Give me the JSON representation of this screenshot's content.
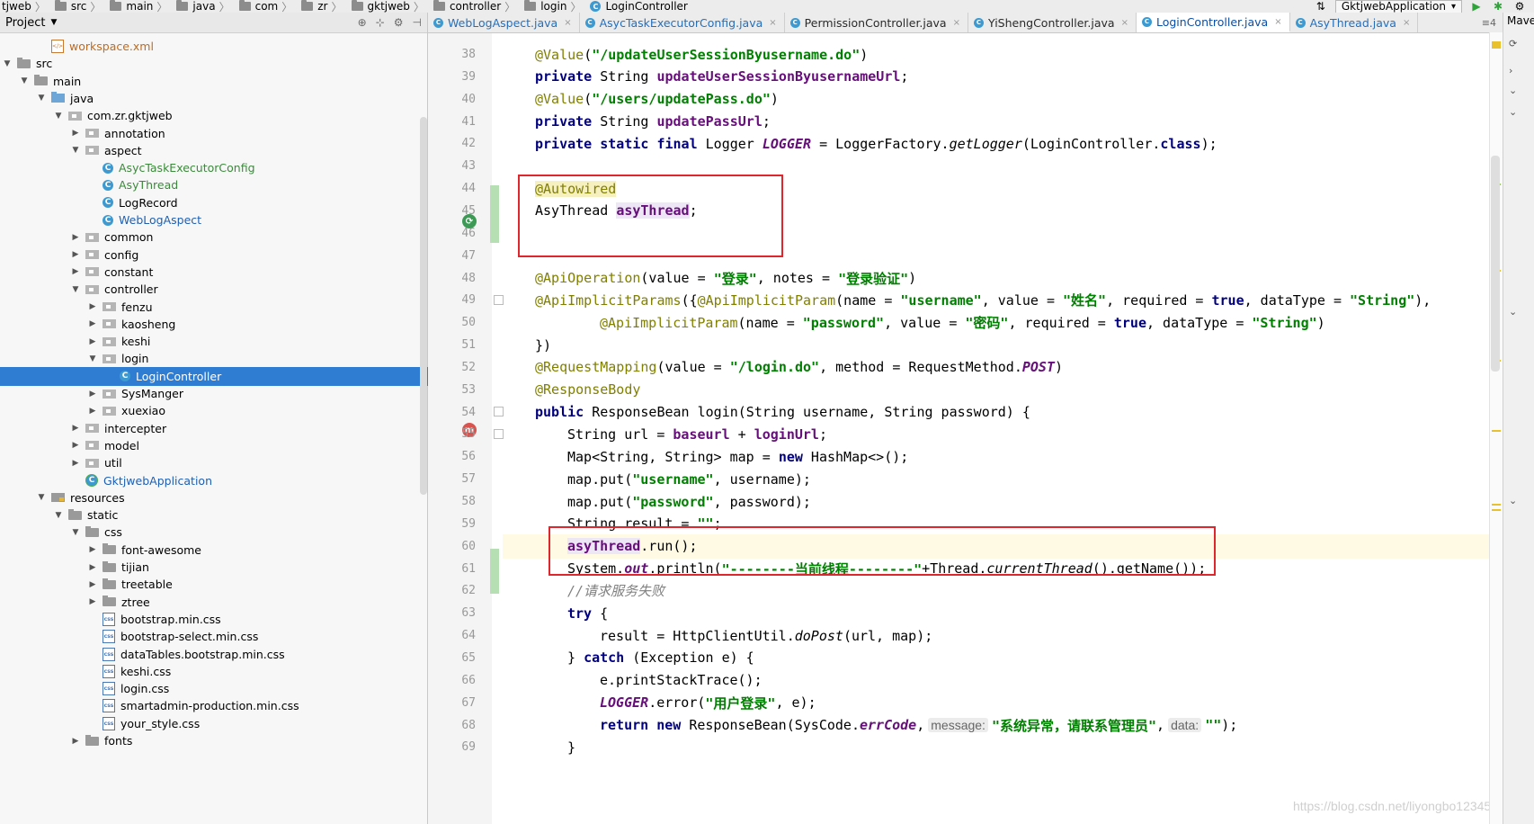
{
  "breadcrumb": [
    {
      "label": "tjweb",
      "icon": "none"
    },
    {
      "label": "src",
      "icon": "folder"
    },
    {
      "label": "main",
      "icon": "folder"
    },
    {
      "label": "java",
      "icon": "folder"
    },
    {
      "label": "com",
      "icon": "folder"
    },
    {
      "label": "zr",
      "icon": "folder"
    },
    {
      "label": "gktjweb",
      "icon": "folder"
    },
    {
      "label": "controller",
      "icon": "folder"
    },
    {
      "label": "login",
      "icon": "folder"
    },
    {
      "label": "LoginController",
      "icon": "class"
    }
  ],
  "run_config": {
    "label": "GktjwebApplication"
  },
  "project_panel": {
    "title": "Project"
  },
  "tree": [
    {
      "label": "workspace.xml",
      "depth": 2,
      "toggle": "",
      "icon": "xml",
      "color": "orange"
    },
    {
      "label": "src",
      "depth": 0,
      "toggle": "open",
      "icon": "folder",
      "color": ""
    },
    {
      "label": "main",
      "depth": 1,
      "toggle": "open",
      "icon": "folder",
      "color": ""
    },
    {
      "label": "java",
      "depth": 2,
      "toggle": "open",
      "icon": "src",
      "color": ""
    },
    {
      "label": "com.zr.gktjweb",
      "depth": 3,
      "toggle": "open",
      "icon": "pkg",
      "color": ""
    },
    {
      "label": "annotation",
      "depth": 4,
      "toggle": "closed",
      "icon": "pkg",
      "color": ""
    },
    {
      "label": "aspect",
      "depth": 4,
      "toggle": "open",
      "icon": "pkg",
      "color": ""
    },
    {
      "label": "AsycTaskExecutorConfig",
      "depth": 5,
      "toggle": "",
      "icon": "cls",
      "color": "green"
    },
    {
      "label": "AsyThread",
      "depth": 5,
      "toggle": "",
      "icon": "cls",
      "color": "green"
    },
    {
      "label": "LogRecord",
      "depth": 5,
      "toggle": "",
      "icon": "cls",
      "color": ""
    },
    {
      "label": "WebLogAspect",
      "depth": 5,
      "toggle": "",
      "icon": "cls",
      "color": "blue"
    },
    {
      "label": "common",
      "depth": 4,
      "toggle": "closed",
      "icon": "pkg",
      "color": ""
    },
    {
      "label": "config",
      "depth": 4,
      "toggle": "closed",
      "icon": "pkg",
      "color": ""
    },
    {
      "label": "constant",
      "depth": 4,
      "toggle": "closed",
      "icon": "pkg",
      "color": ""
    },
    {
      "label": "controller",
      "depth": 4,
      "toggle": "open",
      "icon": "pkg",
      "color": ""
    },
    {
      "label": "fenzu",
      "depth": 5,
      "toggle": "closed",
      "icon": "pkg",
      "color": ""
    },
    {
      "label": "kaosheng",
      "depth": 5,
      "toggle": "closed",
      "icon": "pkg",
      "color": ""
    },
    {
      "label": "keshi",
      "depth": 5,
      "toggle": "closed",
      "icon": "pkg",
      "color": ""
    },
    {
      "label": "login",
      "depth": 5,
      "toggle": "open",
      "icon": "pkg",
      "color": ""
    },
    {
      "label": "LoginController",
      "depth": 6,
      "toggle": "",
      "icon": "cls",
      "color": "blue",
      "selected": true
    },
    {
      "label": "SysManger",
      "depth": 5,
      "toggle": "closed",
      "icon": "pkg",
      "color": ""
    },
    {
      "label": "xuexiao",
      "depth": 5,
      "toggle": "closed",
      "icon": "pkg",
      "color": ""
    },
    {
      "label": "intercepter",
      "depth": 4,
      "toggle": "closed",
      "icon": "pkg",
      "color": ""
    },
    {
      "label": "model",
      "depth": 4,
      "toggle": "closed",
      "icon": "pkg",
      "color": ""
    },
    {
      "label": "util",
      "depth": 4,
      "toggle": "closed",
      "icon": "pkg",
      "color": ""
    },
    {
      "label": "GktjwebApplication",
      "depth": 4,
      "toggle": "",
      "icon": "app",
      "color": "blue"
    },
    {
      "label": "resources",
      "depth": 2,
      "toggle": "open",
      "icon": "res",
      "color": ""
    },
    {
      "label": "static",
      "depth": 3,
      "toggle": "open",
      "icon": "folder",
      "color": ""
    },
    {
      "label": "css",
      "depth": 4,
      "toggle": "open",
      "icon": "folder",
      "color": ""
    },
    {
      "label": "font-awesome",
      "depth": 5,
      "toggle": "closed",
      "icon": "folder",
      "color": ""
    },
    {
      "label": "tijian",
      "depth": 5,
      "toggle": "closed",
      "icon": "folder",
      "color": ""
    },
    {
      "label": "treetable",
      "depth": 5,
      "toggle": "closed",
      "icon": "folder",
      "color": ""
    },
    {
      "label": "ztree",
      "depth": 5,
      "toggle": "closed",
      "icon": "folder",
      "color": ""
    },
    {
      "label": "bootstrap.min.css",
      "depth": 5,
      "toggle": "",
      "icon": "css",
      "color": ""
    },
    {
      "label": "bootstrap-select.min.css",
      "depth": 5,
      "toggle": "",
      "icon": "css",
      "color": ""
    },
    {
      "label": "dataTables.bootstrap.min.css",
      "depth": 5,
      "toggle": "",
      "icon": "css",
      "color": ""
    },
    {
      "label": "keshi.css",
      "depth": 5,
      "toggle": "",
      "icon": "css",
      "color": ""
    },
    {
      "label": "login.css",
      "depth": 5,
      "toggle": "",
      "icon": "css",
      "color": ""
    },
    {
      "label": "smartadmin-production.min.css",
      "depth": 5,
      "toggle": "",
      "icon": "css",
      "color": ""
    },
    {
      "label": "your_style.css",
      "depth": 5,
      "toggle": "",
      "icon": "css",
      "color": ""
    },
    {
      "label": "fonts",
      "depth": 4,
      "toggle": "closed",
      "icon": "folder",
      "color": ""
    }
  ],
  "tabs": [
    {
      "label": "WebLogAspect.java",
      "active": false,
      "modified": true
    },
    {
      "label": "AsycTaskExecutorConfig.java",
      "active": false,
      "modified": true
    },
    {
      "label": "PermissionController.java",
      "active": false,
      "modified": false
    },
    {
      "label": "YiShengController.java",
      "active": false,
      "modified": false
    },
    {
      "label": "LoginController.java",
      "active": true,
      "modified": false
    },
    {
      "label": "AsyThread.java",
      "active": false,
      "modified": true
    }
  ],
  "tab_menu_label": "≡4",
  "right_panel_label": "Mave",
  "code_lines": [
    {
      "n": "38",
      "segs": [
        [
          "pad4",
          ""
        ],
        [
          "ann",
          "@Value"
        ],
        [
          "",
          "("
        ],
        [
          "str",
          "\"/updateUserSessionByusername.do\""
        ],
        [
          "",
          ")"
        ]
      ]
    },
    {
      "n": "39",
      "segs": [
        [
          "pad4",
          ""
        ],
        [
          "kw",
          "private"
        ],
        [
          "",
          " String "
        ],
        [
          "fld",
          "updateUserSessionByusernameUrl"
        ],
        [
          "",
          ";"
        ]
      ]
    },
    {
      "n": "40",
      "segs": [
        [
          "pad4",
          ""
        ],
        [
          "ann",
          "@Value"
        ],
        [
          "",
          "("
        ],
        [
          "str",
          "\"/users/updatePass.do\""
        ],
        [
          "",
          ")"
        ]
      ]
    },
    {
      "n": "41",
      "segs": [
        [
          "pad4",
          ""
        ],
        [
          "kw",
          "private"
        ],
        [
          "",
          " String "
        ],
        [
          "fld",
          "updatePassUrl"
        ],
        [
          "",
          ";"
        ]
      ]
    },
    {
      "n": "42",
      "segs": [
        [
          "pad4",
          ""
        ],
        [
          "kw",
          "private static final"
        ],
        [
          "",
          " Logger "
        ],
        [
          "static-it",
          "LOGGER"
        ],
        [
          "",
          " = LoggerFactory."
        ],
        [
          "it",
          "getLogger"
        ],
        [
          "",
          "(LoginController."
        ],
        [
          "kw",
          "class"
        ],
        [
          "",
          ");"
        ]
      ]
    },
    {
      "n": "43",
      "segs": []
    },
    {
      "n": "44",
      "segs": [
        [
          "pad4",
          ""
        ],
        [
          "ann-hl",
          "@Autowired"
        ]
      ]
    },
    {
      "n": "45",
      "segs": [
        [
          "pad4",
          ""
        ],
        [
          "",
          "AsyThread "
        ],
        [
          "fld-hl",
          "asyThread"
        ],
        [
          "",
          ";"
        ]
      ]
    },
    {
      "n": "46",
      "segs": []
    },
    {
      "n": "47",
      "segs": []
    },
    {
      "n": "48",
      "segs": [
        [
          "pad4",
          ""
        ],
        [
          "ann",
          "@ApiOperation"
        ],
        [
          "",
          "(value = "
        ],
        [
          "str",
          "\"登录\""
        ],
        [
          "",
          ", notes = "
        ],
        [
          "str",
          "\"登录验证\""
        ],
        [
          "",
          ")"
        ]
      ]
    },
    {
      "n": "49",
      "segs": [
        [
          "pad4",
          ""
        ],
        [
          "ann",
          "@ApiImplicitParams"
        ],
        [
          "",
          "({"
        ],
        [
          "ann",
          "@ApiImplicitParam"
        ],
        [
          "",
          "(name = "
        ],
        [
          "str",
          "\"username\""
        ],
        [
          "",
          ", value = "
        ],
        [
          "str",
          "\"姓名\""
        ],
        [
          "",
          ", required = "
        ],
        [
          "kw",
          "true"
        ],
        [
          "",
          ", dataType = "
        ],
        [
          "str",
          "\"String\""
        ],
        [
          "",
          "),"
        ]
      ]
    },
    {
      "n": "50",
      "segs": [
        [
          "pad12",
          ""
        ],
        [
          "ann",
          "@ApiImplicitParam"
        ],
        [
          "",
          "(name = "
        ],
        [
          "str",
          "\"password\""
        ],
        [
          "",
          ", value = "
        ],
        [
          "str",
          "\"密码\""
        ],
        [
          "",
          ", required = "
        ],
        [
          "kw",
          "true"
        ],
        [
          "",
          ", dataType = "
        ],
        [
          "str",
          "\"String\""
        ],
        [
          "",
          ")"
        ]
      ]
    },
    {
      "n": "51",
      "segs": [
        [
          "pad4",
          ""
        ],
        [
          "",
          "})"
        ]
      ]
    },
    {
      "n": "52",
      "segs": [
        [
          "pad4",
          ""
        ],
        [
          "ann",
          "@RequestMapping"
        ],
        [
          "",
          "(value = "
        ],
        [
          "str",
          "\"/login.do\""
        ],
        [
          "",
          ", method = RequestMethod."
        ],
        [
          "static-it",
          "POST"
        ],
        [
          "",
          ")"
        ]
      ]
    },
    {
      "n": "53",
      "segs": [
        [
          "pad4",
          ""
        ],
        [
          "ann",
          "@ResponseBody"
        ]
      ]
    },
    {
      "n": "54",
      "segs": [
        [
          "pad4",
          ""
        ],
        [
          "kw",
          "public"
        ],
        [
          "",
          " ResponseBean login(String username, String password) {"
        ]
      ]
    },
    {
      "n": "55",
      "segs": [
        [
          "pad8",
          ""
        ],
        [
          "",
          "String url = "
        ],
        [
          "fld",
          "baseurl"
        ],
        [
          "",
          " + "
        ],
        [
          "fld",
          "loginUrl"
        ],
        [
          "",
          ";"
        ]
      ]
    },
    {
      "n": "56",
      "segs": [
        [
          "pad8",
          ""
        ],
        [
          "",
          "Map<String, String> map = "
        ],
        [
          "kw",
          "new"
        ],
        [
          "",
          " HashMap<>();"
        ]
      ]
    },
    {
      "n": "57",
      "segs": [
        [
          "pad8",
          ""
        ],
        [
          "",
          "map.put("
        ],
        [
          "str",
          "\"username\""
        ],
        [
          "",
          ", username);"
        ]
      ]
    },
    {
      "n": "58",
      "segs": [
        [
          "pad8",
          ""
        ],
        [
          "",
          "map.put("
        ],
        [
          "str",
          "\"password\""
        ],
        [
          "",
          ", password);"
        ]
      ]
    },
    {
      "n": "59",
      "segs": [
        [
          "pad8",
          ""
        ],
        [
          "",
          "String result = "
        ],
        [
          "str",
          "\"\""
        ],
        [
          "",
          ";"
        ]
      ]
    },
    {
      "n": "60",
      "segs": [
        [
          "pad8",
          ""
        ],
        [
          "fld-hl",
          "asyThread"
        ],
        [
          "",
          ".run();"
        ]
      ],
      "hl": true
    },
    {
      "n": "61",
      "segs": [
        [
          "pad8",
          ""
        ],
        [
          "",
          "System."
        ],
        [
          "static-it",
          "out"
        ],
        [
          "",
          ".println("
        ],
        [
          "str",
          "\"--------当前线程--------\""
        ],
        [
          "",
          "+Thread."
        ],
        [
          "it",
          "currentThread"
        ],
        [
          "",
          "().getName());"
        ]
      ]
    },
    {
      "n": "62",
      "segs": [
        [
          "pad8",
          ""
        ],
        [
          "cmt",
          "//请求服务失败"
        ]
      ]
    },
    {
      "n": "63",
      "segs": [
        [
          "pad8",
          ""
        ],
        [
          "kw",
          "try"
        ],
        [
          "",
          " {"
        ]
      ]
    },
    {
      "n": "64",
      "segs": [
        [
          "pad12",
          ""
        ],
        [
          "",
          "result = HttpClientUtil."
        ],
        [
          "it",
          "doPost"
        ],
        [
          "",
          "(url, map);"
        ]
      ]
    },
    {
      "n": "65",
      "segs": [
        [
          "pad8",
          ""
        ],
        [
          "",
          "} "
        ],
        [
          "kw",
          "catch"
        ],
        [
          "",
          " (Exception e) {"
        ]
      ]
    },
    {
      "n": "66",
      "segs": [
        [
          "pad12",
          ""
        ],
        [
          "",
          "e.printStackTrace();"
        ]
      ]
    },
    {
      "n": "67",
      "segs": [
        [
          "pad12",
          ""
        ],
        [
          "static-it",
          "LOGGER"
        ],
        [
          "",
          ".error("
        ],
        [
          "str",
          "\"用户登录\""
        ],
        [
          "",
          ", e);"
        ]
      ]
    },
    {
      "n": "68",
      "segs": [
        [
          "pad12",
          ""
        ],
        [
          "kw",
          "return new"
        ],
        [
          "",
          " ResponseBean(SysCode."
        ],
        [
          "static-it",
          "errCode"
        ],
        [
          "",
          ","
        ],
        [
          "hint",
          "message:"
        ],
        [
          "str",
          "\"系统异常，请联系管理员\""
        ],
        [
          "",
          ","
        ],
        [
          "hint",
          "data:"
        ],
        [
          "str",
          "\"\""
        ],
        [
          "",
          ");"
        ]
      ]
    },
    {
      "n": "69",
      "segs": [
        [
          "pad8",
          ""
        ],
        [
          "",
          "}"
        ]
      ]
    }
  ],
  "watermark": "https://blog.csdn.net/liyongbo123456"
}
